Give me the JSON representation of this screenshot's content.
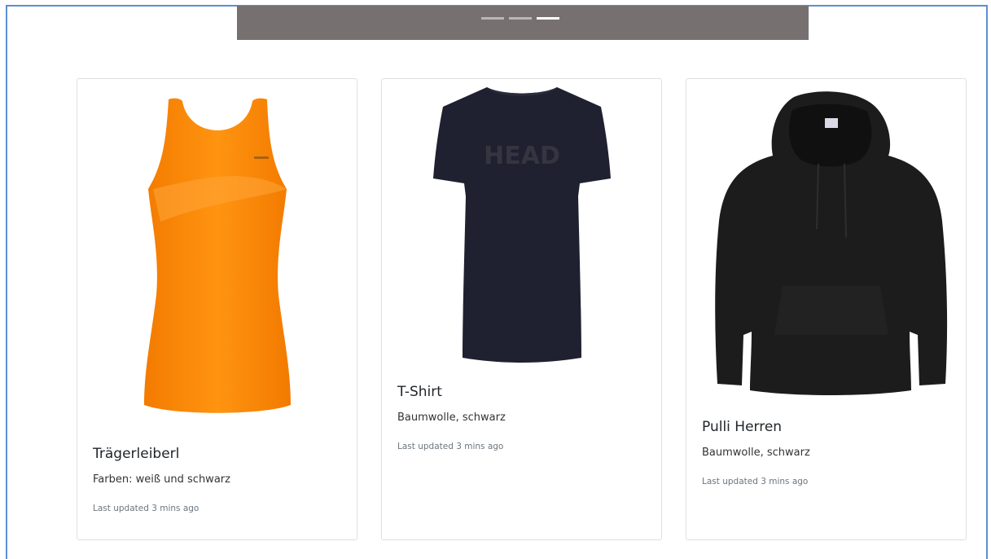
{
  "carousel": {
    "indicators": [
      {
        "label": "Slide 1",
        "active": false
      },
      {
        "label": "Slide 2",
        "active": false
      },
      {
        "label": "Slide 3",
        "active": true
      }
    ]
  },
  "cards": [
    {
      "title": "Trägerleiberl",
      "text": "Farben: weiß und schwarz",
      "updated": "Last updated 3 mins ago",
      "image_icon": "orange-tank-top-image"
    },
    {
      "title": "T-Shirt",
      "text": "Baumwolle, schwarz",
      "updated": "Last updated 3 mins ago",
      "image_icon": "black-tshirt-image",
      "print_text": "HEAD"
    },
    {
      "title": "Pulli Herren",
      "text": "Baumwolle, schwarz",
      "updated": "Last updated 3 mins ago",
      "image_icon": "black-hoodie-image"
    }
  ],
  "colors": {
    "carousel_bg": "#767170",
    "frame_border": "#5b8fd1",
    "tank_orange": "#ff8a00",
    "tshirt_dark": "#1f2030",
    "hoodie_dark": "#1c1c1c"
  }
}
